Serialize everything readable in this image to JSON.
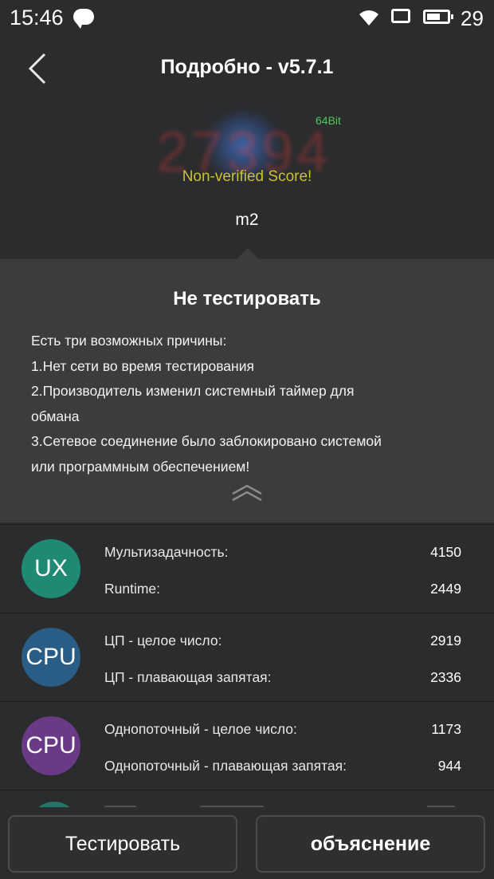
{
  "status_bar": {
    "time": "15:46",
    "battery_level": "29"
  },
  "header": {
    "title": "Подробно - v5.7.1"
  },
  "score": {
    "value": "27394",
    "bitness": "64Bit",
    "status": "Non-verified Score!",
    "device": "m2"
  },
  "popup": {
    "title": "Не тестировать",
    "lines": [
      "Есть три возможных причины:",
      "1.Нет сети во время тестирования",
      "2.Производитель изменил системный таймер для",
      "обмана",
      "3.Сетевое соединение было заблокировано системой",
      "или программным обеспечением!"
    ]
  },
  "results": [
    {
      "icon_label": "UX",
      "icon_color": "#1f8a73",
      "items": [
        {
          "label": "Мультизадачность:",
          "value": "4150"
        },
        {
          "label": "Runtime:",
          "value": "2449"
        }
      ]
    },
    {
      "icon_label": "CPU",
      "icon_color": "#2a5d86",
      "items": [
        {
          "label": "ЦП - целое число:",
          "value": "2919"
        },
        {
          "label": "ЦП - плавающая запятая:",
          "value": "2336"
        }
      ]
    },
    {
      "icon_label": "CPU",
      "icon_color": "#6b3a86",
      "items": [
        {
          "label": "Однопоточный - целое число:",
          "value": "1173"
        },
        {
          "label": "Однопоточный - плавающая запятая:",
          "value": "944"
        }
      ]
    }
  ],
  "buttons": {
    "test": "Тестировать",
    "explain": "объяснение"
  },
  "icons": [
    "chat-icon",
    "wifi-icon",
    "sim-icon",
    "battery-icon",
    "back-arrow-icon",
    "collapse-chevron-icon"
  ]
}
